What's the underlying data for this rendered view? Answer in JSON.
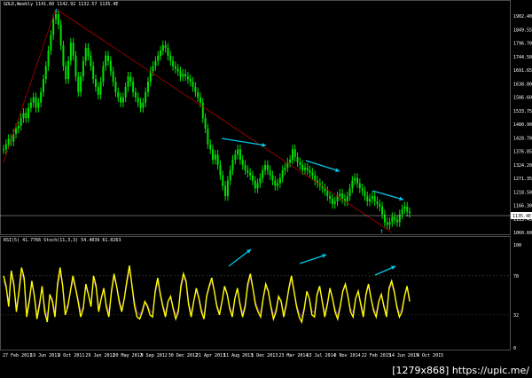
{
  "window": {
    "main_header": "GOLD,Weekly  1141.60 1142.92 1132.57 1135.4E",
    "sub_header": "RSI(5) 41.7766   Stoch(11,3,3) 54.4039 61.0263"
  },
  "watermark": "[1279x868] https://upic.me/",
  "price_axis": [
    "1902.40",
    "1849.55",
    "1796.70",
    "1744.50",
    "1691.65",
    "1638.80",
    "1586.60",
    "1533.75",
    "1480.90",
    "1428.70",
    "1376.85",
    "1324.20",
    "1271.35",
    "1218.50",
    "1166.30",
    "1113.45",
    "1060.60"
  ],
  "current_price": "1135.4E",
  "osc_axis": [
    "100",
    "70",
    "32",
    "0"
  ],
  "date_axis": [
    "27 Feb 2011",
    "19 Jun 2011",
    "9 Oct 2011",
    "29 Jan 2012",
    "20 May 2012",
    "9 Sep 2012",
    "30 Dec 2012",
    "21 Apr 2013",
    "11 Aug 2013",
    "1 Dec 2013",
    "23 Mar 2014",
    "13 Jul 2014",
    "2 Nov 2014",
    "22 Feb 2015",
    "14 Jun 2015",
    "4 Oct 2015"
  ],
  "colors": {
    "candle": "#00e000",
    "trend": "#b00000",
    "arrow": "#00c8e8",
    "rsi": "#ffff00",
    "stoch": "#7030a0",
    "axis": "#808080",
    "grid": "#404040"
  },
  "chart_data": {
    "type": "line",
    "price": [
      1380,
      1400,
      1420,
      1410,
      1440,
      1460,
      1470,
      1500,
      1520,
      1500,
      1540,
      1560,
      1580,
      1540,
      1560,
      1600,
      1650,
      1700,
      1760,
      1820,
      1880,
      1900,
      1860,
      1780,
      1700,
      1650,
      1720,
      1790,
      1740,
      1660,
      1600,
      1660,
      1720,
      1770,
      1740,
      1700,
      1650,
      1620,
      1590,
      1640,
      1700,
      1740,
      1720,
      1680,
      1640,
      1600,
      1580,
      1560,
      1580,
      1620,
      1660,
      1640,
      1600,
      1580,
      1560,
      1540,
      1560,
      1600,
      1640,
      1680,
      1700,
      1720,
      1740,
      1760,
      1780,
      1770,
      1740,
      1720,
      1700,
      1690,
      1680,
      1660,
      1670,
      1660,
      1650,
      1640,
      1620,
      1600,
      1580,
      1560,
      1500,
      1460,
      1400,
      1380,
      1340,
      1360,
      1320,
      1280,
      1240,
      1200,
      1260,
      1300,
      1340,
      1360,
      1380,
      1340,
      1320,
      1300,
      1290,
      1280,
      1260,
      1230,
      1250,
      1270,
      1300,
      1320,
      1300,
      1280,
      1260,
      1240,
      1250,
      1270,
      1300,
      1310,
      1330,
      1340,
      1380,
      1350,
      1330,
      1320,
      1300,
      1310,
      1300,
      1290,
      1280,
      1260,
      1250,
      1240,
      1230,
      1220,
      1200,
      1190,
      1170,
      1180,
      1200,
      1210,
      1190,
      1180,
      1200,
      1230,
      1260,
      1270,
      1250,
      1230,
      1220,
      1200,
      1180,
      1190,
      1200,
      1180,
      1170,
      1160,
      1130,
      1100,
      1090,
      1100,
      1120,
      1110,
      1100,
      1130,
      1150,
      1160,
      1140,
      1135
    ],
    "rsi": [
      70,
      60,
      40,
      75,
      62,
      35,
      55,
      78,
      68,
      30,
      45,
      65,
      50,
      28,
      42,
      60,
      35,
      25,
      52,
      45,
      30,
      62,
      78,
      60,
      32,
      40,
      55,
      70,
      58,
      45,
      30,
      38,
      62,
      52,
      40,
      70,
      60,
      35,
      48,
      58,
      40,
      30,
      55,
      72,
      60,
      45,
      35,
      48,
      65,
      80,
      60,
      40,
      30,
      28,
      35,
      45,
      40,
      32,
      30,
      55,
      68,
      52,
      40,
      30,
      45,
      50,
      38,
      28,
      35,
      60,
      72,
      65,
      42,
      30,
      45,
      58,
      48,
      35,
      28,
      50,
      60,
      68,
      55,
      40,
      32,
      45,
      60,
      52,
      38,
      30,
      48,
      58,
      42,
      30,
      40,
      62,
      72,
      58,
      42,
      35,
      30,
      48,
      62,
      55,
      40,
      28,
      35,
      50,
      45,
      30,
      42,
      58,
      70,
      55,
      40,
      30,
      25,
      38,
      55,
      48,
      32,
      30,
      52,
      60,
      45,
      30,
      42,
      58,
      48,
      35,
      28,
      40,
      55,
      62,
      50,
      35,
      30,
      48,
      55,
      42,
      30,
      52,
      62,
      48,
      36,
      30,
      45,
      52,
      40,
      30,
      58,
      65,
      55,
      40,
      30,
      35,
      50,
      60,
      45
    ],
    "stoch": [
      65,
      58,
      45,
      70,
      60,
      40,
      52,
      72,
      65,
      35,
      48,
      62,
      52,
      32,
      45,
      58,
      40,
      30,
      50,
      48,
      35,
      58,
      72,
      62,
      38,
      42,
      55,
      65,
      58,
      48,
      35,
      40,
      58,
      52,
      42,
      65,
      58,
      40,
      48,
      55,
      42,
      35,
      52,
      68,
      60,
      48,
      38,
      48,
      62,
      75,
      62,
      45,
      35,
      32,
      38,
      45,
      42,
      36,
      34,
      52,
      64,
      54,
      42,
      34,
      45,
      50,
      40,
      32,
      38,
      56,
      68,
      64,
      45,
      34,
      45,
      55,
      50,
      38,
      32,
      48,
      58,
      64,
      56,
      42,
      35,
      45,
      58,
      52,
      40,
      34,
      48,
      56,
      44,
      34,
      42,
      58,
      68,
      58,
      45,
      38,
      34,
      48,
      58,
      55,
      42,
      32,
      38,
      50,
      46,
      34,
      44,
      56,
      66,
      56,
      42,
      34,
      30,
      40,
      54,
      48,
      36,
      34,
      50,
      58,
      46,
      34,
      44,
      56,
      48,
      38,
      32,
      42,
      54,
      60,
      50,
      38,
      34,
      48,
      54,
      44,
      34,
      50,
      60,
      48,
      38,
      34,
      46,
      52,
      42,
      34,
      56,
      62,
      54,
      42,
      34,
      38,
      50,
      58,
      48
    ],
    "price_range": [
      1060.6,
      1920
    ],
    "osc_range": [
      0,
      100
    ],
    "levels": [
      70,
      32
    ],
    "trendlines": [
      [
        1330,
        1920
      ],
      [
        1920,
        1060
      ]
    ],
    "arrows": [
      "top",
      "bottom"
    ]
  }
}
